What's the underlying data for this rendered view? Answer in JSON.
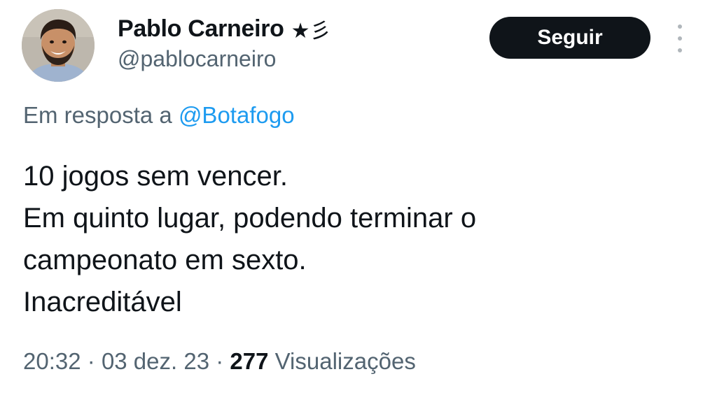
{
  "author": {
    "display_name": "Pablo Carneiro",
    "badge": "★彡",
    "handle": "@pablocarneiro"
  },
  "actions": {
    "follow_label": "Seguir",
    "more_icon": "more-vertical-icon"
  },
  "reply": {
    "prefix": "Em resposta a",
    "mention": "@Botafogo"
  },
  "tweet": {
    "lines": [
      "10 jogos sem vencer.",
      "Em quinto lugar, podendo terminar o",
      "campeonato em sexto.",
      "Inacreditável"
    ]
  },
  "meta": {
    "time": "20:32",
    "separator": "·",
    "date": "03 dez. 23",
    "views_count": "277",
    "views_label": "Visualizações"
  },
  "colors": {
    "text_primary": "#0f1419",
    "text_secondary": "#536471",
    "link": "#1d9bf0",
    "button_bg": "#0f1419"
  }
}
